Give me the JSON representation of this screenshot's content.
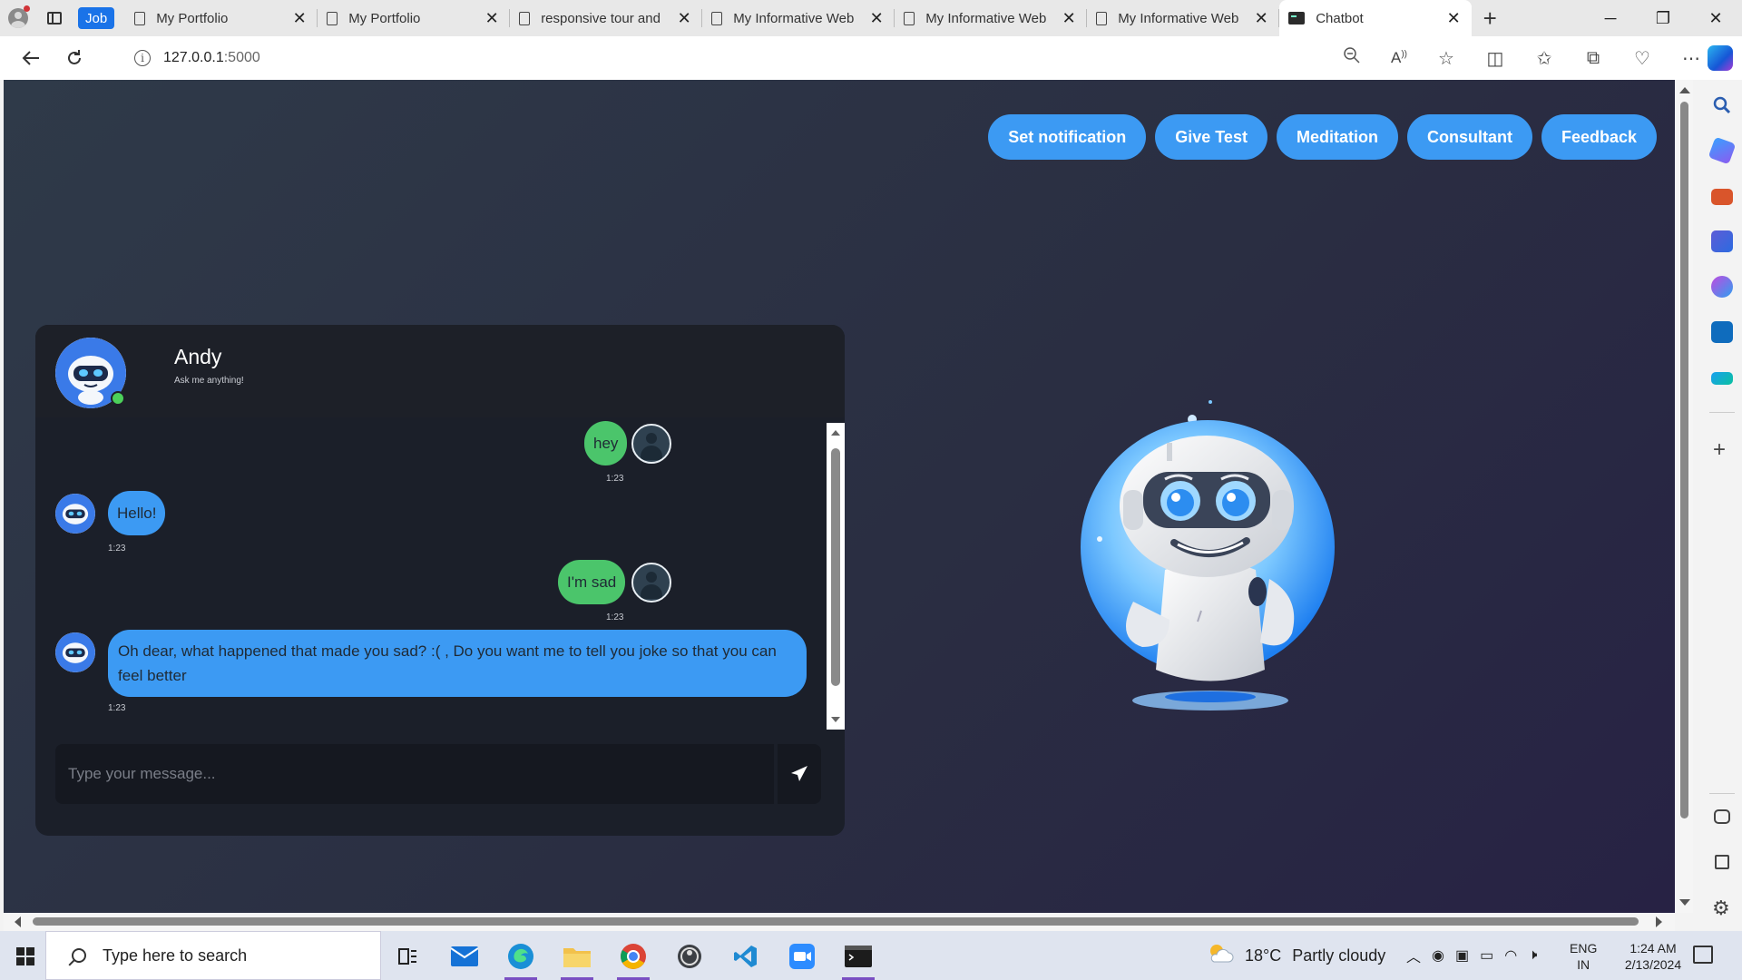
{
  "browser": {
    "group_chip": "Job",
    "tabs": [
      {
        "title": "My Portfolio"
      },
      {
        "title": "My Portfolio"
      },
      {
        "title": "responsive tour and"
      },
      {
        "title": "My Informative Web"
      },
      {
        "title": "My Informative Web"
      },
      {
        "title": "My Informative Web"
      },
      {
        "title": "Chatbot"
      }
    ],
    "new_tab": "+",
    "window_controls": {
      "minimize": "─",
      "restore": "❐",
      "close": "✕"
    },
    "address": {
      "host": "127.0.0.1",
      "port": ":5000"
    }
  },
  "nav": {
    "buttons": [
      {
        "label": "Set notification"
      },
      {
        "label": "Give Test"
      },
      {
        "label": "Meditation"
      },
      {
        "label": "Consultant"
      },
      {
        "label": "Feedback"
      }
    ]
  },
  "chat": {
    "bot_name": "Andy",
    "subtitle": "Ask me anything!",
    "messages": [
      {
        "from": "user",
        "text": "hey",
        "time": "1:23"
      },
      {
        "from": "bot",
        "text": "Hello!",
        "time": "1:23"
      },
      {
        "from": "user",
        "text": "I'm sad",
        "time": "1:23"
      },
      {
        "from": "bot",
        "text": "Oh dear, what happened that made you sad? :( , Do you want me to tell you joke so that you can feel better",
        "time": "1:23"
      }
    ],
    "input_placeholder": "Type your message..."
  },
  "taskbar": {
    "search_placeholder": "Type here to search",
    "weather": {
      "temp": "18°C",
      "condition": "Partly cloudy"
    },
    "language": {
      "line1": "ENG",
      "line2": "IN"
    },
    "clock": {
      "time": "1:24 AM",
      "date": "2/13/2024"
    }
  },
  "colors": {
    "accent_blue": "#3c9af3",
    "user_bubble": "#4bc56b",
    "online_dot": "#4cd15a",
    "page_bg": "#2f3a49"
  }
}
